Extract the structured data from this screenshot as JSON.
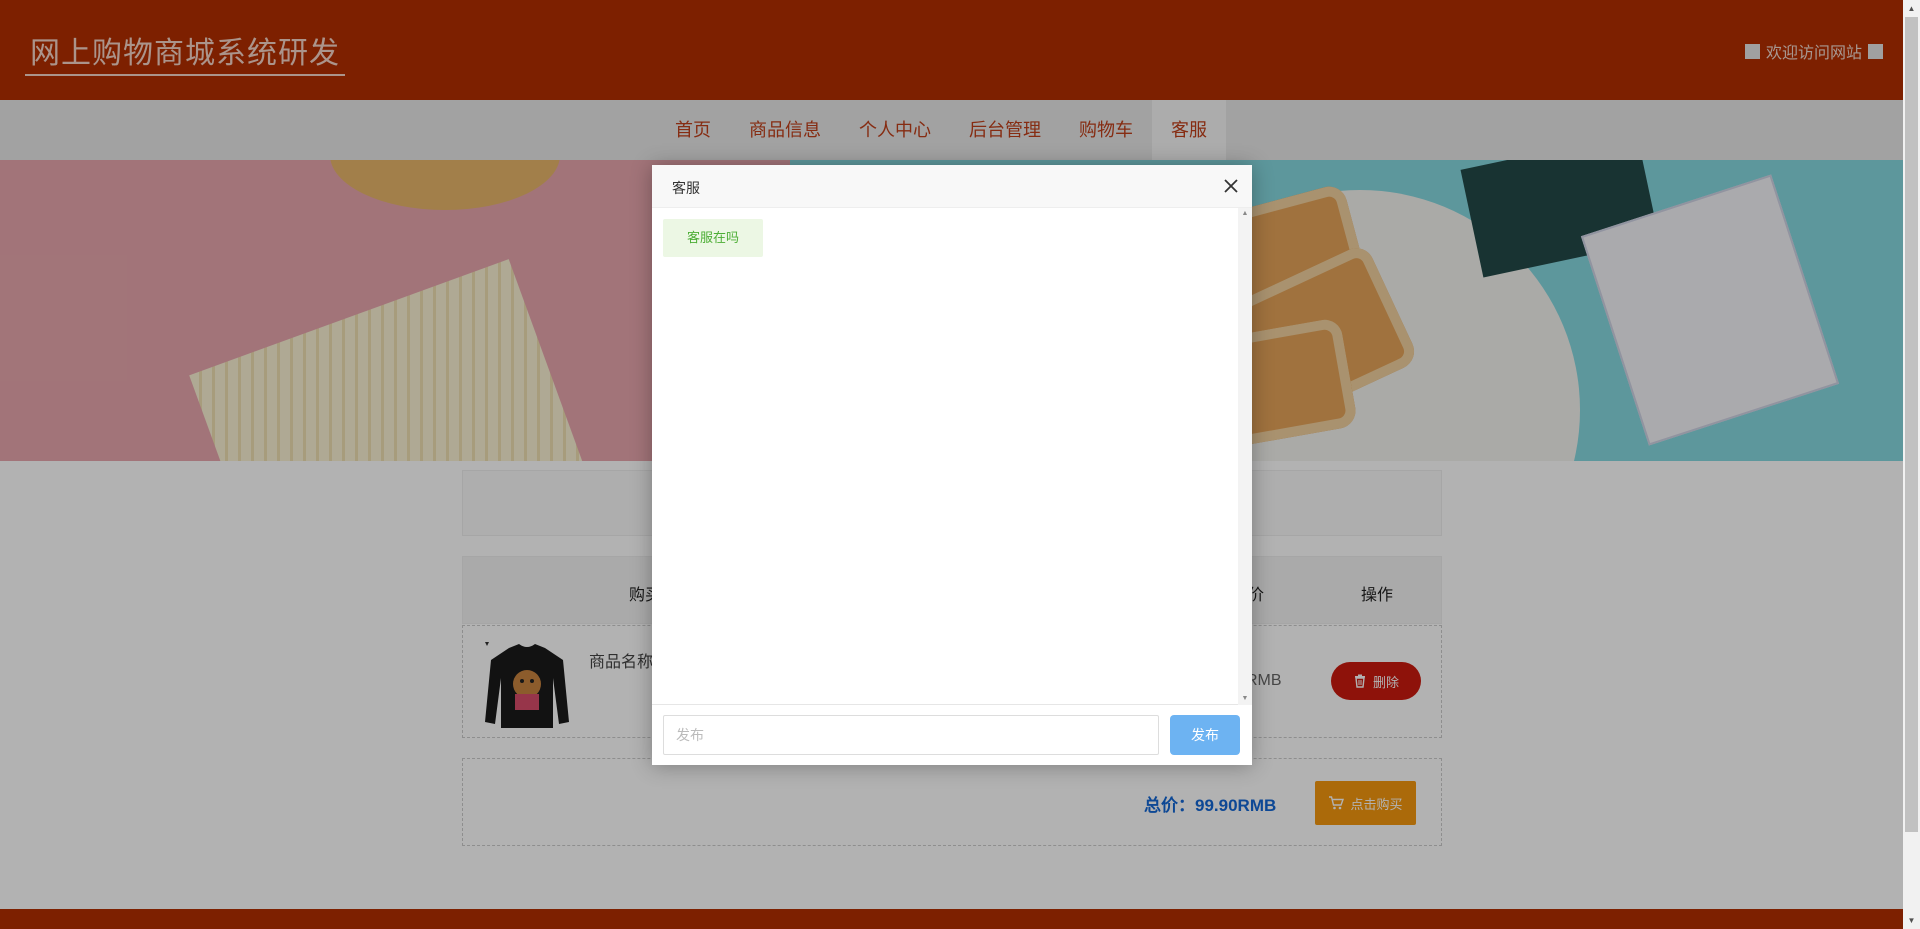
{
  "header": {
    "site_title": "网上购物商城系统研发",
    "welcome": "欢迎访问网站"
  },
  "nav": {
    "items": [
      {
        "label": "首页"
      },
      {
        "label": "商品信息"
      },
      {
        "label": "个人中心"
      },
      {
        "label": "后台管理"
      },
      {
        "label": "购物车"
      },
      {
        "label": "客服",
        "active": true
      }
    ]
  },
  "cart": {
    "columns": {
      "buy": "购买",
      "price": "价",
      "action": "操作"
    },
    "item": {
      "name": "商品名称",
      "price": "RMB",
      "delete_label": "删除"
    },
    "total": "总价：99.90RMB",
    "buy_label": "点击购买"
  },
  "dialog": {
    "title": "客服",
    "messages": [
      "客服在吗"
    ],
    "input_placeholder": "发布",
    "send_label": "发布"
  },
  "colors": {
    "brand": "#b32e00",
    "nav_text": "#c0401a",
    "delete": "#cc1b0f",
    "buy": "#f5990f",
    "send": "#6db3f2",
    "total": "#1467d6"
  }
}
